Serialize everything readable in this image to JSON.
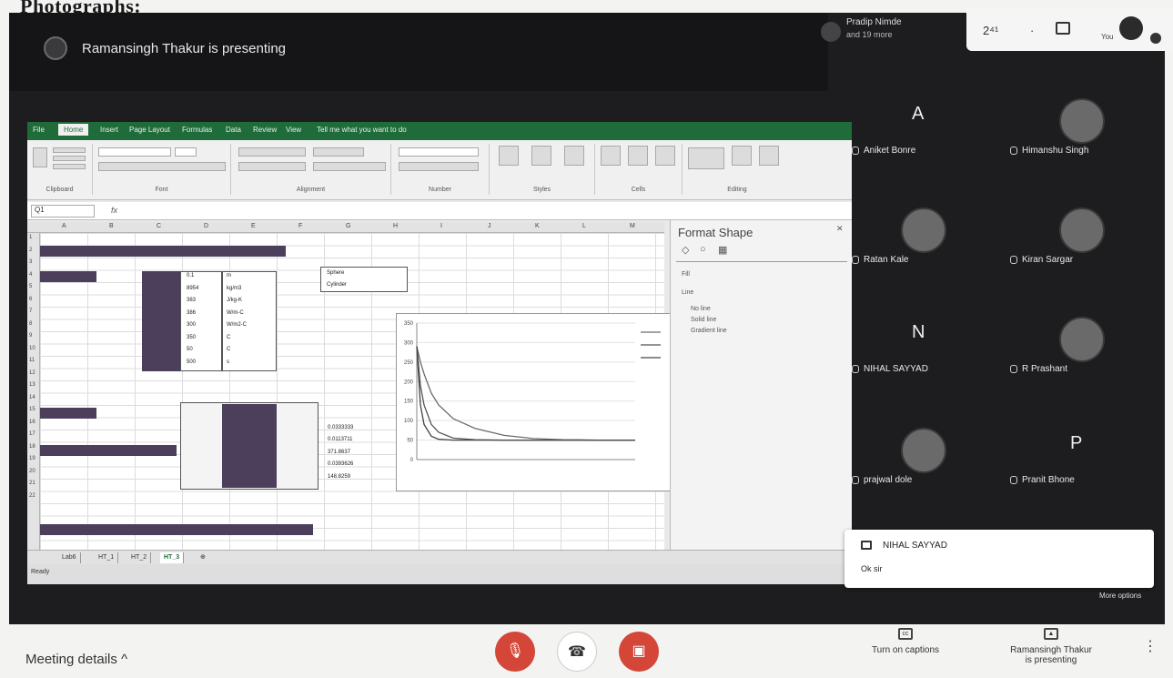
{
  "heading": "Photographs:",
  "presenter_banner": "Ramansingh Thakur is presenting",
  "raise_hand": {
    "name": "Pradip Nimde",
    "sub": "and 19 more"
  },
  "top_right": {
    "count": "2⁴¹",
    "you_label": "You"
  },
  "excel": {
    "tabs": [
      "File",
      "Home",
      "Insert",
      "Page Layout",
      "Formulas",
      "Data",
      "Review",
      "View",
      "Tell me what you want to do"
    ],
    "groups": [
      "Clipboard",
      "Font",
      "Alignment",
      "Number",
      "Styles",
      "Cells",
      "Editing"
    ],
    "name_box": "Q1",
    "col_headers": [
      "A",
      "B",
      "C",
      "D",
      "E",
      "F",
      "G",
      "H",
      "I",
      "J",
      "K",
      "L",
      "M"
    ],
    "values_d": [
      "0.1",
      "8954",
      "383",
      "386",
      "300",
      "350",
      "50",
      "500"
    ],
    "values_e": [
      "m",
      "kg/m3",
      "J/kg-K",
      "W/m-C",
      "W/m2-C",
      "C",
      "C",
      "s"
    ],
    "sphere_table": [
      "Sphere",
      "Cylinder"
    ],
    "lower_values": [
      "0.0333333",
      "0.0113711",
      "371.8637",
      "0.0393626",
      "148.8259"
    ],
    "status_ready": "Ready",
    "sheet_tabs": [
      "Lab6",
      "HT_1",
      "HT_2",
      "HT_3"
    ]
  },
  "chart_data": {
    "type": "line",
    "title": "",
    "xlabel": "",
    "ylabel": "",
    "xlim": [
      0,
      3000
    ],
    "ylim": [
      0,
      350
    ],
    "y_ticks": [
      0,
      50,
      100,
      150,
      200,
      250,
      300,
      350
    ],
    "series": [
      {
        "x": [
          0,
          50,
          100,
          200,
          300,
          500,
          800,
          1200,
          1600,
          2000,
          2500,
          3000
        ],
        "values": [
          290,
          250,
          220,
          170,
          140,
          105,
          80,
          62,
          54,
          51,
          50,
          50
        ]
      },
      {
        "x": [
          0,
          50,
          100,
          200,
          300,
          500,
          800,
          1200,
          1600,
          2000,
          2500,
          3000
        ],
        "values": [
          290,
          190,
          140,
          90,
          70,
          55,
          51,
          50,
          50,
          50,
          50,
          50
        ]
      },
      {
        "x": [
          0,
          50,
          100,
          200,
          300,
          500,
          800,
          1200,
          1600,
          2000,
          2500,
          3000
        ],
        "values": [
          290,
          140,
          90,
          60,
          52,
          50,
          50,
          50,
          50,
          50,
          50,
          50
        ]
      }
    ]
  },
  "format_shape": {
    "title": "Format Shape",
    "options": [
      "Fill",
      "Line",
      "No line",
      "Solid line",
      "Gradient line"
    ]
  },
  "participants": [
    {
      "letter": "A",
      "name": "Aniket Bonre"
    },
    {
      "photo": true,
      "name": "Himanshu Singh"
    },
    {
      "photo": true,
      "name": "Ratan Kale"
    },
    {
      "photo": true,
      "name": "Kiran Sargar"
    },
    {
      "letter": "N",
      "name": "NIHAL SAYYAD"
    },
    {
      "photo": true,
      "name": "R Prashant"
    },
    {
      "photo": true,
      "name": "prajwal dole"
    },
    {
      "letter": "P",
      "name": "Pranit Bhone"
    }
  ],
  "notification": {
    "name": "NIHAL SAYYAD",
    "message": "Ok sir"
  },
  "bottom": {
    "meeting_details": "Meeting details",
    "captions": "Turn on captions",
    "presenting": "Ramansingh Thakur\nis presenting",
    "more_options": "More options"
  }
}
